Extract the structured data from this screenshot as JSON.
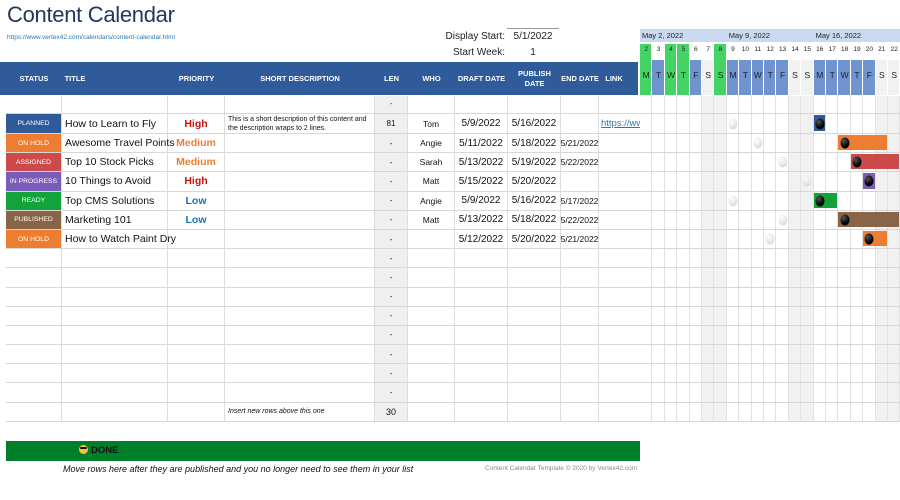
{
  "header": {
    "title": "Content Calendar",
    "url": "https://www.vertex42.com/calendars/content-calendar.html",
    "display_start_label": "Display Start:",
    "display_start_value": "5/1/2022",
    "start_week_label": "Start Week:",
    "start_week_value": "1"
  },
  "columns": {
    "status": "STATUS",
    "title": "TITLE",
    "priority": "PRIORITY",
    "description": "SHORT DESCRIPTION",
    "len": "LEN",
    "who": "WHO",
    "draft": "DRAFT DATE",
    "publish": "PUBLISH DATE",
    "end": "END DATE",
    "link": "LINK"
  },
  "status_colors": {
    "PLANNED": "#2f5b9a",
    "ON HOLD": "#ed7d31",
    "ASSIGNED": "#cc4a4a",
    "IN PROGRESS": "#7b5cb8",
    "READY": "#12a33a",
    "PUBLISHED": "#8a6446"
  },
  "priority_colors": {
    "High": "#cc1010",
    "Medium": "#ed7d31",
    "Low": "#1a6fb8"
  },
  "first_row_len": "-",
  "rows": [
    {
      "status": "PLANNED",
      "title": "How to Learn to Fly",
      "priority": "High",
      "description": "This is a short description of this content and the description wraps to 2 lines.",
      "len": "81",
      "who": "Tom",
      "draft": "5/9/2022",
      "publish": "5/16/2022",
      "end": "",
      "link": "https://ww",
      "bar_start_day": 16,
      "bar_end_day": 16,
      "draft_day": 9
    },
    {
      "status": "ON HOLD",
      "title": "Awesome Travel Points",
      "priority": "Medium",
      "description": "",
      "len": "-",
      "who": "Angie",
      "draft": "5/11/2022",
      "publish": "5/18/2022",
      "end": "5/21/2022",
      "link": "",
      "bar_start_day": 18,
      "bar_end_day": 21,
      "draft_day": 11
    },
    {
      "status": "ASSIGNED",
      "title": "Top 10 Stock Picks",
      "priority": "Medium",
      "description": "",
      "len": "-",
      "who": "Sarah",
      "draft": "5/13/2022",
      "publish": "5/19/2022",
      "end": "5/22/2022",
      "link": "",
      "bar_start_day": 19,
      "bar_end_day": 22,
      "draft_day": 13
    },
    {
      "status": "IN PROGRESS",
      "title": "10 Things to Avoid",
      "priority": "High",
      "description": "",
      "len": "-",
      "who": "Matt",
      "draft": "5/15/2022",
      "publish": "5/20/2022",
      "end": "",
      "link": "",
      "bar_start_day": 20,
      "bar_end_day": 20,
      "draft_day": 15
    },
    {
      "status": "READY",
      "title": "Top CMS Solutions",
      "priority": "Low",
      "description": "",
      "len": "-",
      "who": "Angie",
      "draft": "5/9/2022",
      "publish": "5/16/2022",
      "end": "5/17/2022",
      "link": "",
      "bar_start_day": 16,
      "bar_end_day": 17,
      "draft_day": 9
    },
    {
      "status": "PUBLISHED",
      "title": "Marketing 101",
      "priority": "Low",
      "description": "",
      "len": "-",
      "who": "Matt",
      "draft": "5/13/2022",
      "publish": "5/18/2022",
      "end": "5/22/2022",
      "link": "",
      "bar_start_day": 18,
      "bar_end_day": 22,
      "draft_day": 13
    },
    {
      "status": "ON HOLD",
      "title": "How to Watch Paint Dry",
      "priority": "",
      "description": "",
      "len": "-",
      "who": "",
      "draft": "5/12/2022",
      "publish": "5/20/2022",
      "end": "5/21/2022",
      "link": "",
      "bar_start_day": 20,
      "bar_end_day": 21,
      "draft_day": 12
    }
  ],
  "empty_row_len": "-",
  "empty_row_count": 8,
  "footer_row": {
    "description": "Insert new rows above this one",
    "len": "30"
  },
  "gantt": {
    "months": [
      {
        "label": "May 2, 2022",
        "start_index": 0
      },
      {
        "label": "May 9, 2022",
        "start_index": 7
      },
      {
        "label": "May 16, 2022",
        "start_index": 14
      }
    ],
    "days": [
      {
        "num": "2",
        "dow": "M",
        "highlight": true
      },
      {
        "num": "3",
        "dow": "T",
        "highlight": false
      },
      {
        "num": "4",
        "dow": "W",
        "highlight": true
      },
      {
        "num": "5",
        "dow": "T",
        "highlight": true
      },
      {
        "num": "6",
        "dow": "F",
        "highlight": false
      },
      {
        "num": "7",
        "dow": "S",
        "highlight": false
      },
      {
        "num": "8",
        "dow": "S",
        "highlight": true
      },
      {
        "num": "9",
        "dow": "M",
        "highlight": false
      },
      {
        "num": "10",
        "dow": "T",
        "highlight": false
      },
      {
        "num": "11",
        "dow": "W",
        "highlight": false
      },
      {
        "num": "12",
        "dow": "T",
        "highlight": false
      },
      {
        "num": "13",
        "dow": "F",
        "highlight": false
      },
      {
        "num": "14",
        "dow": "S",
        "highlight": false
      },
      {
        "num": "15",
        "dow": "S",
        "highlight": false
      },
      {
        "num": "16",
        "dow": "M",
        "highlight": false
      },
      {
        "num": "17",
        "dow": "T",
        "highlight": false
      },
      {
        "num": "18",
        "dow": "W",
        "highlight": false
      },
      {
        "num": "19",
        "dow": "T",
        "highlight": false
      },
      {
        "num": "20",
        "dow": "F",
        "highlight": false
      },
      {
        "num": "21",
        "dow": "S",
        "highlight": false
      },
      {
        "num": "22",
        "dow": "S",
        "highlight": false
      }
    ],
    "colors": {
      "highlight": "#44d465",
      "weekday": "#6f93cf",
      "weekend": "#f1f1f1",
      "month_bar": "#c9d9ef"
    }
  },
  "done": {
    "label": "DONE",
    "note": "Move rows here after they are published and you no longer need to see them in your list",
    "copyright": "Content Calendar Template © 2020 by Vertex42.com"
  }
}
